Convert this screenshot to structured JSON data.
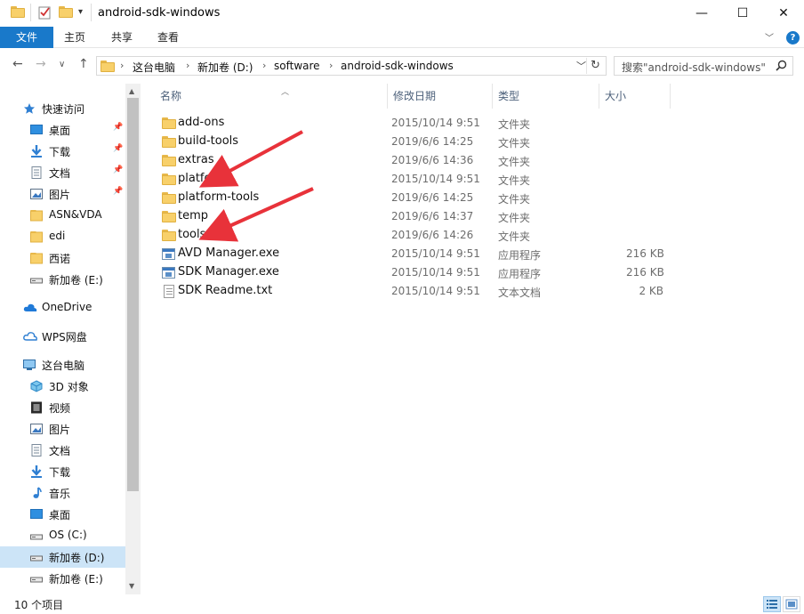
{
  "window": {
    "title": "android-sdk-windows",
    "minimize": "—",
    "maximize": "☐",
    "close": "✕"
  },
  "ribbon": {
    "tabs": [
      "文件",
      "主页",
      "共享",
      "查看"
    ],
    "expand": "﹀",
    "help": "?"
  },
  "address": {
    "crumbs": [
      "这台电脑",
      "新加卷 (D:)",
      "software",
      "android-sdk-windows"
    ],
    "separator": "›",
    "dropdown": "﹀",
    "refresh": "↻"
  },
  "search": {
    "placeholder": "搜索\"android-sdk-windows\"",
    "icon": "search-icon"
  },
  "nav": {
    "back": "←",
    "forward": "→",
    "recent": "∨",
    "up": "↑",
    "items": [
      {
        "label": "快速访问",
        "icon": "star-icon"
      },
      {
        "label": "桌面",
        "icon": "desktop-icon",
        "pinned": true
      },
      {
        "label": "下载",
        "icon": "download-icon",
        "pinned": true
      },
      {
        "label": "文档",
        "icon": "document-icon",
        "pinned": true
      },
      {
        "label": "图片",
        "icon": "picture-icon",
        "pinned": true
      },
      {
        "label": "ASN&VDA",
        "icon": "folder-icon"
      },
      {
        "label": "edi",
        "icon": "folder-icon"
      },
      {
        "label": "西诺",
        "icon": "folder-icon"
      },
      {
        "label": "新加卷 (E:)",
        "icon": "drive-icon"
      },
      {
        "label": "OneDrive",
        "icon": "cloud-icon"
      },
      {
        "label": "WPS网盘",
        "icon": "wps-cloud-icon"
      },
      {
        "label": "这台电脑",
        "icon": "computer-icon"
      },
      {
        "label": "3D 对象",
        "icon": "cube-icon"
      },
      {
        "label": "视频",
        "icon": "video-icon"
      },
      {
        "label": "图片",
        "icon": "picture-icon"
      },
      {
        "label": "文档",
        "icon": "document-icon"
      },
      {
        "label": "下载",
        "icon": "download-icon"
      },
      {
        "label": "音乐",
        "icon": "music-icon"
      },
      {
        "label": "桌面",
        "icon": "desktop-icon"
      },
      {
        "label": "OS (C:)",
        "icon": "drive-icon"
      },
      {
        "label": "新加卷 (D:)",
        "icon": "drive-icon",
        "selected": true
      },
      {
        "label": "新加卷 (E:)",
        "icon": "drive-icon"
      }
    ]
  },
  "columns": {
    "name": "名称",
    "date": "修改日期",
    "type": "类型",
    "size": "大小"
  },
  "files": [
    {
      "name": "add-ons",
      "date": "2015/10/14 9:51",
      "type": "文件夹",
      "size": "",
      "icon": "folder-icon"
    },
    {
      "name": "build-tools",
      "date": "2019/6/6 14:25",
      "type": "文件夹",
      "size": "",
      "icon": "folder-icon"
    },
    {
      "name": "extras",
      "date": "2019/6/6 14:36",
      "type": "文件夹",
      "size": "",
      "icon": "folder-icon"
    },
    {
      "name": "platforms",
      "date": "2015/10/14 9:51",
      "type": "文件夹",
      "size": "",
      "icon": "folder-icon"
    },
    {
      "name": "platform-tools",
      "date": "2019/6/6 14:25",
      "type": "文件夹",
      "size": "",
      "icon": "folder-icon"
    },
    {
      "name": "temp",
      "date": "2019/6/6 14:37",
      "type": "文件夹",
      "size": "",
      "icon": "folder-icon"
    },
    {
      "name": "tools",
      "date": "2019/6/6 14:26",
      "type": "文件夹",
      "size": "",
      "icon": "folder-icon"
    },
    {
      "name": "AVD Manager.exe",
      "date": "2015/10/14 9:51",
      "type": "应用程序",
      "size": "216 KB",
      "icon": "exe-icon"
    },
    {
      "name": "SDK Manager.exe",
      "date": "2015/10/14 9:51",
      "type": "应用程序",
      "size": "216 KB",
      "icon": "exe-icon"
    },
    {
      "name": "SDK Readme.txt",
      "date": "2015/10/14 9:51",
      "type": "文本文档",
      "size": "2 KB",
      "icon": "text-file-icon"
    }
  ],
  "status": {
    "count": "10 个项目"
  },
  "colors": {
    "accent": "#1979ca",
    "selection": "#cce4f7",
    "annotation_arrow": "#e8323a"
  }
}
